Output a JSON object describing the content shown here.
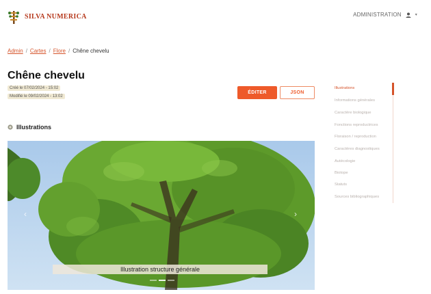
{
  "header": {
    "brand_name": "SILVA NUMERICA",
    "admin_label": "ADMINISTRATION",
    "user_icon": "user-icon",
    "caret": "▾"
  },
  "breadcrumb": {
    "items": [
      "Admin",
      "Cartes",
      "Flore"
    ],
    "current": "Chêne chevelu",
    "separator": "/"
  },
  "page": {
    "title": "Chêne chevelu",
    "created": "Créé le 07/02/2024 - 15:02",
    "modified": "Modifié le 09/02/2024 - 13:02"
  },
  "actions": {
    "edit_label": "ÉDITER",
    "json_label": "JSON"
  },
  "section": {
    "title": "Illustrations"
  },
  "sidenav": {
    "items": [
      "Illustrations",
      "Informations générales",
      "Caractère biologique",
      "Fonctions reproductrices",
      "Floraison / reproduction",
      "Caractères diagnostiques",
      "Autécologie",
      "Biotope",
      "Statuts",
      "Sources bibliographiques"
    ],
    "active_index": 0
  },
  "carousel": {
    "caption": "Illustration structure générale",
    "prev_icon": "‹",
    "next_icon": "›",
    "slide_count": 3,
    "active_slide": 1
  },
  "colors": {
    "accent": "#ee5a2a",
    "brand": "#b5371a",
    "sky": "#b8d4ee",
    "foliage": "#5d9a2a"
  }
}
